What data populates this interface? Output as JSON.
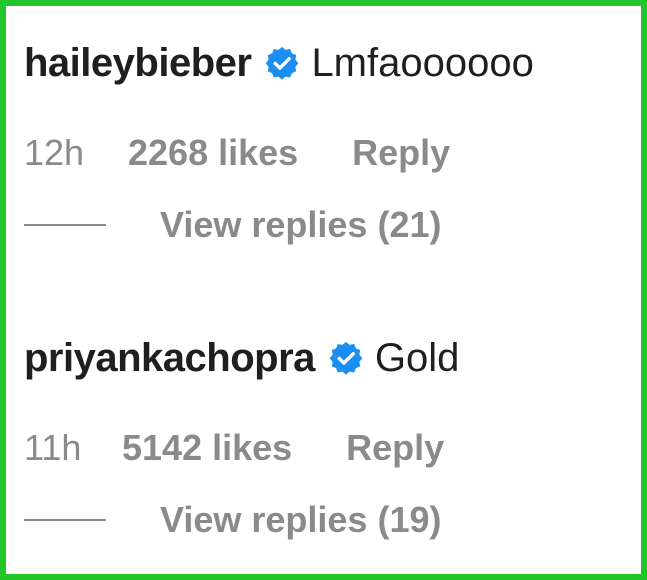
{
  "comments": [
    {
      "username": "haileybieber",
      "text": "Lmfaoooooo",
      "time": "12h",
      "likes": "2268 likes",
      "reply_label": "Reply",
      "view_replies_label": "View replies (21)"
    },
    {
      "username": "priyankachopra",
      "text": "Gold",
      "time": "11h",
      "likes": "5142 likes",
      "reply_label": "Reply",
      "view_replies_label": "View replies (19)"
    }
  ],
  "icons": {
    "verified": "verified-badge-icon"
  },
  "colors": {
    "frame_border": "#22c52a",
    "verified_blue": "#1b8ef2",
    "primary_text": "#1f1f1f",
    "secondary_text": "#8a8a8a"
  }
}
